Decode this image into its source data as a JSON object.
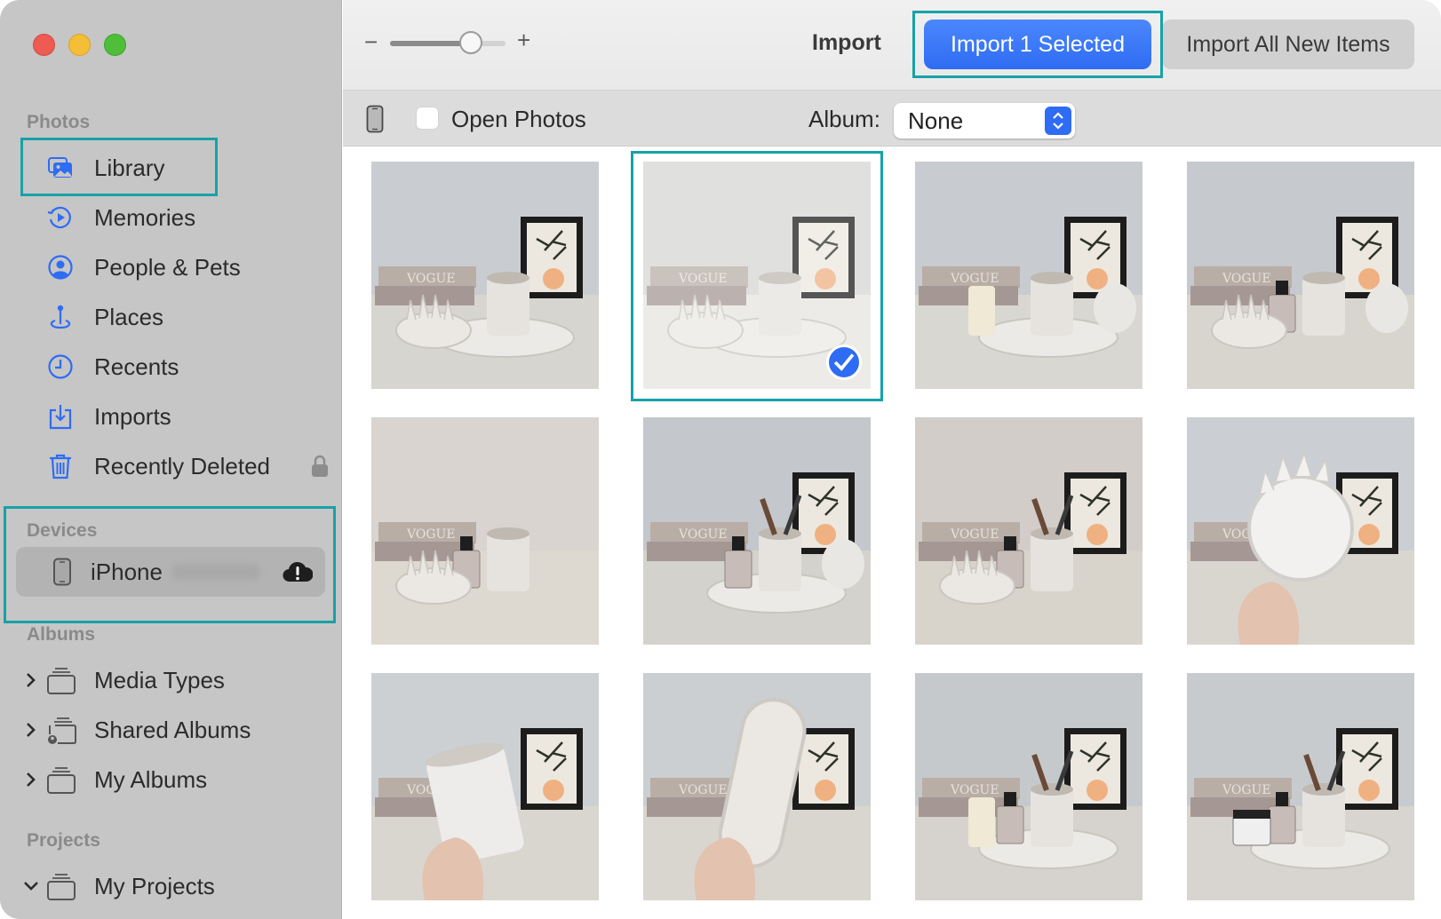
{
  "window": {
    "traffic_lights": [
      "close",
      "minimize",
      "maximize"
    ]
  },
  "sidebar": {
    "sections": {
      "photos": "Photos",
      "devices": "Devices",
      "albums": "Albums",
      "projects": "Projects"
    },
    "photos_items": [
      {
        "label": "Library",
        "icon": "library-icon"
      },
      {
        "label": "Memories",
        "icon": "memories-icon"
      },
      {
        "label": "People & Pets",
        "icon": "people-icon"
      },
      {
        "label": "Places",
        "icon": "places-icon"
      },
      {
        "label": "Recents",
        "icon": "recents-icon"
      },
      {
        "label": "Imports",
        "icon": "imports-icon"
      },
      {
        "label": "Recently Deleted",
        "icon": "trash-icon",
        "locked": true
      }
    ],
    "device": {
      "label": "iPhone",
      "status_icon": "cloud-alert-icon"
    },
    "album_items": [
      {
        "label": "Media Types",
        "expanded": false
      },
      {
        "label": "Shared Albums",
        "expanded": false
      },
      {
        "label": "My Albums",
        "expanded": false
      }
    ],
    "project_items": [
      {
        "label": "My Projects",
        "expanded": true
      }
    ]
  },
  "toolbar": {
    "zoom_minus": "−",
    "zoom_plus": "+",
    "zoom_level": 0.7,
    "title": "Import",
    "import_selected_label": "Import 1 Selected",
    "import_all_label": "Import All New Items"
  },
  "subbar": {
    "open_photos_label": "Open Photos",
    "open_photos_checked": false,
    "album_label": "Album:",
    "album_value": "None"
  },
  "grid": {
    "photos": [
      {
        "id": 1,
        "selected": false,
        "scene": "trays-vogue"
      },
      {
        "id": 2,
        "selected": true,
        "scene": "trays-top"
      },
      {
        "id": 3,
        "selected": false,
        "scene": "candle-tray"
      },
      {
        "id": 4,
        "selected": false,
        "scene": "perfume-jewelry"
      },
      {
        "id": 5,
        "selected": false,
        "scene": "perfume-jewelry-close"
      },
      {
        "id": 6,
        "selected": false,
        "scene": "brushes-tray"
      },
      {
        "id": 7,
        "selected": false,
        "scene": "brushes-mirror"
      },
      {
        "id": 8,
        "selected": false,
        "scene": "hand-dish"
      },
      {
        "id": 9,
        "selected": false,
        "scene": "hand-cup"
      },
      {
        "id": 10,
        "selected": false,
        "scene": "hand-tray"
      },
      {
        "id": 11,
        "selected": false,
        "scene": "brushes-candle"
      },
      {
        "id": 12,
        "selected": false,
        "scene": "skincare-set"
      }
    ]
  },
  "colors": {
    "accent": "#2f6cf4",
    "highlight": "#17a2a8",
    "sidebar_bg": "#c6c6c6",
    "icon_blue": "#2f6cf4"
  }
}
